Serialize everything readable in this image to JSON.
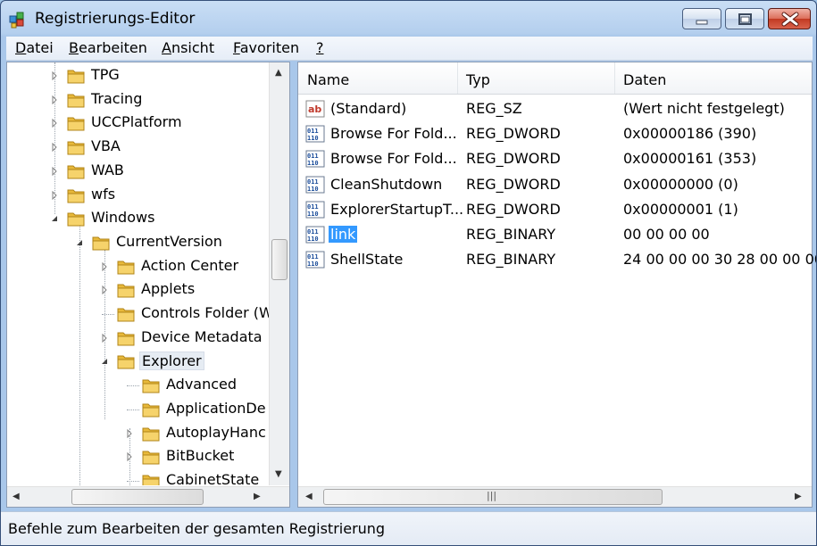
{
  "window": {
    "title": "Registrierungs-Editor"
  },
  "menu": [
    {
      "pre": "",
      "key": "D",
      "post": "atei"
    },
    {
      "pre": "",
      "key": "B",
      "post": "earbeiten"
    },
    {
      "pre": "",
      "key": "A",
      "post": "nsicht"
    },
    {
      "pre": "",
      "key": "F",
      "post": "avoriten"
    },
    {
      "pre": "",
      "key": "?",
      "post": ""
    }
  ],
  "tree": {
    "items": [
      {
        "label": "TPG",
        "level": 0,
        "expander": "collapsed"
      },
      {
        "label": "Tracing",
        "level": 0,
        "expander": "collapsed"
      },
      {
        "label": "UCCPlatform",
        "level": 0,
        "expander": "collapsed"
      },
      {
        "label": "VBA",
        "level": 0,
        "expander": "collapsed"
      },
      {
        "label": "WAB",
        "level": 0,
        "expander": "collapsed"
      },
      {
        "label": "wfs",
        "level": 0,
        "expander": "collapsed"
      },
      {
        "label": "Windows",
        "level": 0,
        "expander": "expanded"
      },
      {
        "label": "CurrentVersion",
        "level": 1,
        "expander": "expanded"
      },
      {
        "label": "Action Center",
        "level": 2,
        "expander": "collapsed"
      },
      {
        "label": "Applets",
        "level": 2,
        "expander": "collapsed"
      },
      {
        "label": "Controls Folder (W",
        "level": 2,
        "expander": "none"
      },
      {
        "label": "Device Metadata",
        "level": 2,
        "expander": "collapsed"
      },
      {
        "label": "Explorer",
        "level": 2,
        "expander": "expanded",
        "selected": true
      },
      {
        "label": "Advanced",
        "level": 3,
        "expander": "none"
      },
      {
        "label": "ApplicationDe",
        "level": 3,
        "expander": "none"
      },
      {
        "label": "AutoplayHanc",
        "level": 3,
        "expander": "collapsed"
      },
      {
        "label": "BitBucket",
        "level": 3,
        "expander": "collapsed"
      },
      {
        "label": "CabinetState",
        "level": 3,
        "expander": "none"
      }
    ]
  },
  "list": {
    "columns": [
      "Name",
      "Typ",
      "Daten"
    ],
    "rows": [
      {
        "icon": "string-value-icon",
        "name": "(Standard)",
        "type": "REG_SZ",
        "data": "(Wert nicht festgelegt)"
      },
      {
        "icon": "binary-value-icon",
        "name": "Browse For Fold...",
        "type": "REG_DWORD",
        "data": "0x00000186 (390)"
      },
      {
        "icon": "binary-value-icon",
        "name": "Browse For Fold...",
        "type": "REG_DWORD",
        "data": "0x00000161 (353)"
      },
      {
        "icon": "binary-value-icon",
        "name": "CleanShutdown",
        "type": "REG_DWORD",
        "data": "0x00000000 (0)"
      },
      {
        "icon": "binary-value-icon",
        "name": "ExplorerStartupT...",
        "type": "REG_DWORD",
        "data": "0x00000001 (1)"
      },
      {
        "icon": "binary-value-icon",
        "name": "link",
        "type": "REG_BINARY",
        "data": "00 00 00 00",
        "selected": true
      },
      {
        "icon": "binary-value-icon",
        "name": "ShellState",
        "type": "REG_BINARY",
        "data": "24 00 00 00 30 28 00 00 00 0"
      }
    ]
  },
  "status": {
    "text": "Befehle zum Bearbeiten der gesamten Registrierung"
  },
  "colors": {
    "selection": "#3399ff",
    "folder": "#e8b93a",
    "titlebar": "#b4cfee"
  }
}
